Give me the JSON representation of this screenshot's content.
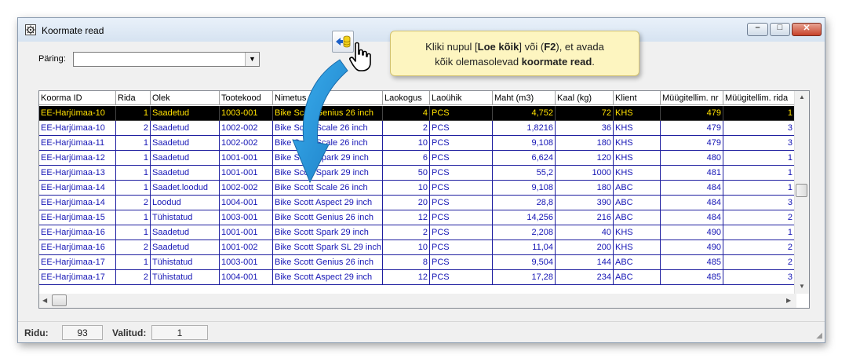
{
  "window": {
    "title": "Koormate read",
    "minimize_glyph": "–",
    "maximize_glyph": "□",
    "close_glyph": "✕"
  },
  "query": {
    "label": "Päring:",
    "value": "",
    "arrow": "▼"
  },
  "tooltip": {
    "part1": "Kliki nupul [",
    "bold1": "Loe kõik",
    "part2": "] või (",
    "bold2": "F2",
    "part3": "), et avada",
    "part4": "kõik olemasolevad ",
    "bold3": "koormate read",
    "part5": "."
  },
  "grid": {
    "columns": [
      "Koorma ID",
      "Rida",
      "Olek",
      "Tootekood",
      "Nimetus",
      "Laokogus",
      "Laoühik",
      "Maht (m3)",
      "Kaal (kg)",
      "Klient",
      "Müügitellim. nr",
      "Müügitellim. rida"
    ],
    "rows": [
      [
        "EE-Harjümaa-10",
        "1",
        "Saadetud",
        "1003-001",
        "Bike Scott Genius 26 inch",
        "4",
        "PCS",
        "4,752",
        "72",
        "KHS",
        "479",
        "1"
      ],
      [
        "EE-Harjümaa-10",
        "2",
        "Saadetud",
        "1002-002",
        "Bike Scott Scale 26 inch",
        "2",
        "PCS",
        "1,8216",
        "36",
        "KHS",
        "479",
        "3"
      ],
      [
        "EE-Harjümaa-11",
        "1",
        "Saadetud",
        "1002-002",
        "Bike Scott Scale 26 inch",
        "10",
        "PCS",
        "9,108",
        "180",
        "KHS",
        "479",
        "3"
      ],
      [
        "EE-Harjümaa-12",
        "1",
        "Saadetud",
        "1001-001",
        "Bike Scott Spark 29 inch",
        "6",
        "PCS",
        "6,624",
        "120",
        "KHS",
        "480",
        "1"
      ],
      [
        "EE-Harjümaa-13",
        "1",
        "Saadetud",
        "1001-001",
        "Bike Scott Spark 29 inch",
        "50",
        "PCS",
        "55,2",
        "1000",
        "KHS",
        "481",
        "1"
      ],
      [
        "EE-Harjümaa-14",
        "1",
        "Saadet.loodud",
        "1002-002",
        "Bike Scott Scale 26 inch",
        "10",
        "PCS",
        "9,108",
        "180",
        "ABC",
        "484",
        "1"
      ],
      [
        "EE-Harjümaa-14",
        "2",
        "Loodud",
        "1004-001",
        "Bike Scott Aspect 29 inch",
        "20",
        "PCS",
        "28,8",
        "390",
        "ABC",
        "484",
        "3"
      ],
      [
        "EE-Harjümaa-15",
        "1",
        "Tühistatud",
        "1003-001",
        "Bike Scott Genius 26 inch",
        "12",
        "PCS",
        "14,256",
        "216",
        "ABC",
        "484",
        "2"
      ],
      [
        "EE-Harjümaa-16",
        "1",
        "Saadetud",
        "1001-001",
        "Bike Scott Spark 29 inch",
        "2",
        "PCS",
        "2,208",
        "40",
        "KHS",
        "490",
        "1"
      ],
      [
        "EE-Harjümaa-16",
        "2",
        "Saadetud",
        "1001-002",
        "Bike Scott Spark SL 29 inch",
        "10",
        "PCS",
        "11,04",
        "200",
        "KHS",
        "490",
        "2"
      ],
      [
        "EE-Harjümaa-17",
        "1",
        "Tühistatud",
        "1003-001",
        "Bike Scott Genius 26 inch",
        "8",
        "PCS",
        "9,504",
        "144",
        "ABC",
        "485",
        "2"
      ],
      [
        "EE-Harjümaa-17",
        "2",
        "Tühistatud",
        "1004-001",
        "Bike Scott Aspect 29 inch",
        "12",
        "PCS",
        "17,28",
        "234",
        "ABC",
        "485",
        "3"
      ]
    ]
  },
  "status": {
    "count_label": "Ridu:",
    "count_value": "93",
    "selected_label": "Valitud:",
    "selected_value": "1"
  },
  "icons": {
    "title": "window-gear-icon",
    "load_all": "load-all-database-icon",
    "cursor": "hand-cursor-icon"
  },
  "colors": {
    "row_text": "#1515b5",
    "selected_bg": "#000000",
    "selected_text": "#ffe000",
    "tooltip_bg": "#fdf5c0",
    "arrow": "#2a9be0"
  }
}
